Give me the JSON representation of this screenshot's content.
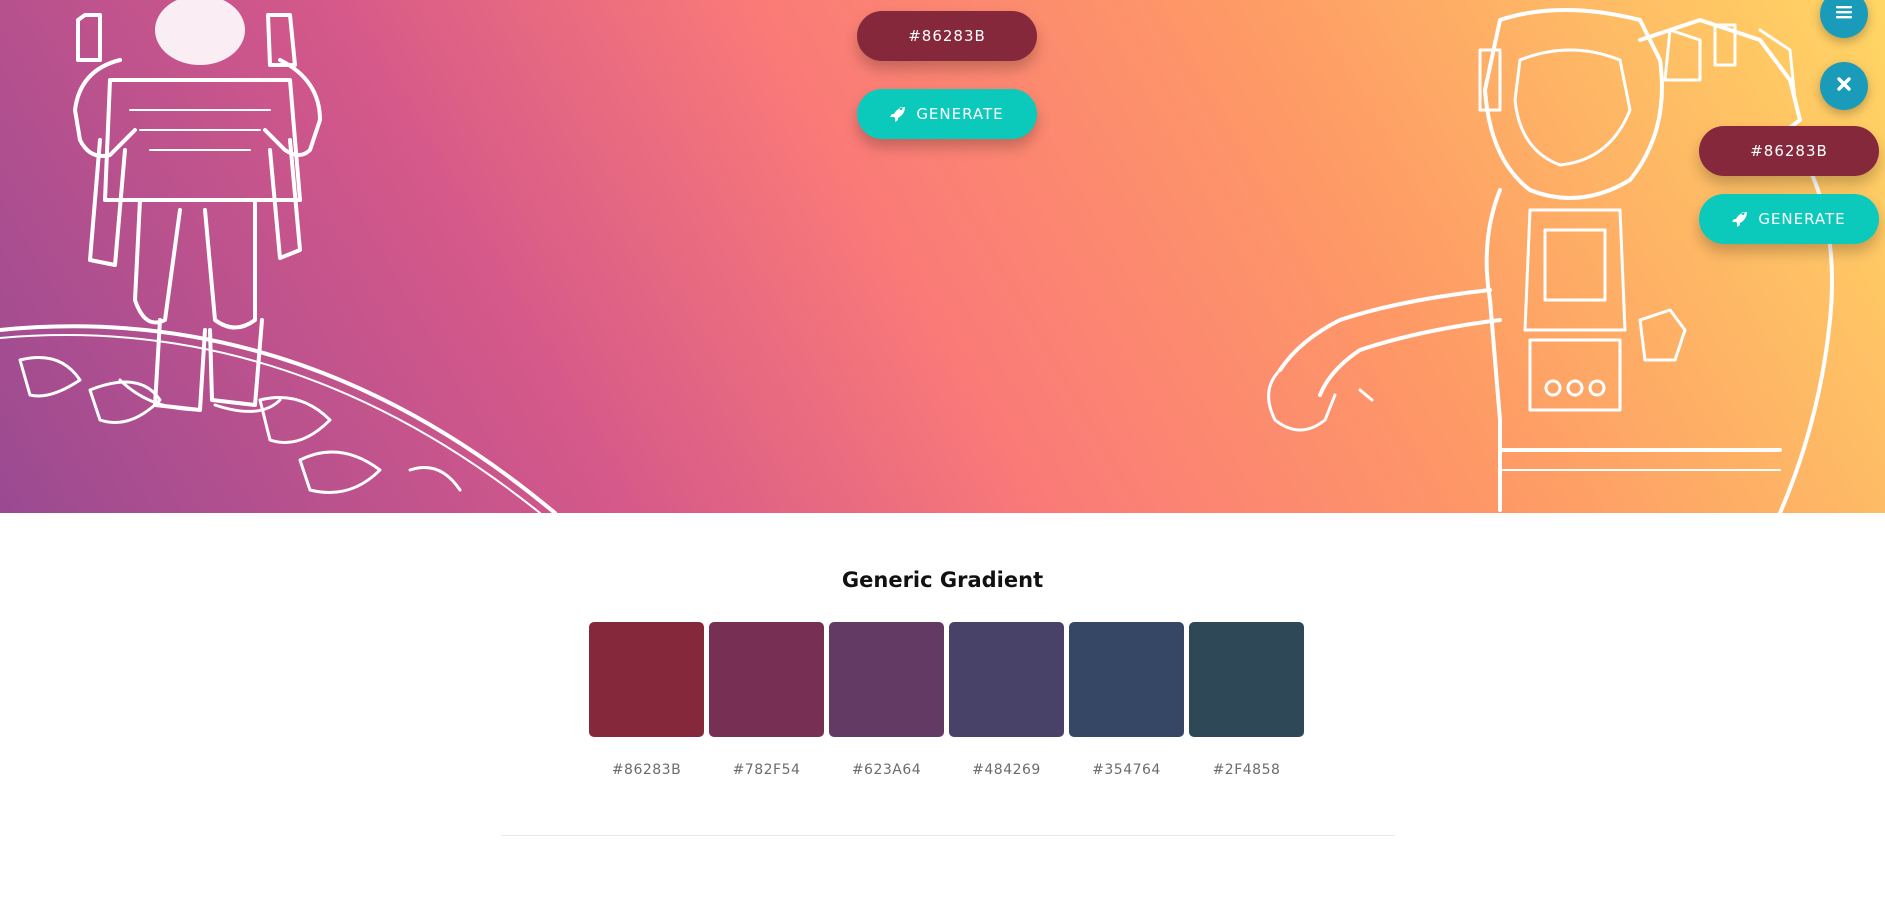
{
  "hero": {
    "hex_button_label": "#86283B",
    "generate_label": "GENERATE"
  },
  "floating": {
    "hex_button_label": "#86283B",
    "generate_label": "GENERATE"
  },
  "section": {
    "title": "Generic Gradient"
  },
  "palette": [
    {
      "hex": "#86283B"
    },
    {
      "hex": "#782F54"
    },
    {
      "hex": "#623A64"
    },
    {
      "hex": "#484269"
    },
    {
      "hex": "#354764"
    },
    {
      "hex": "#2F4858"
    }
  ],
  "colors": {
    "primary": "#86283B",
    "generate": "#0ccabb",
    "menu_button": "#1b9bba"
  },
  "icons": [
    "menu-icon",
    "close-icon",
    "rocket-icon"
  ]
}
